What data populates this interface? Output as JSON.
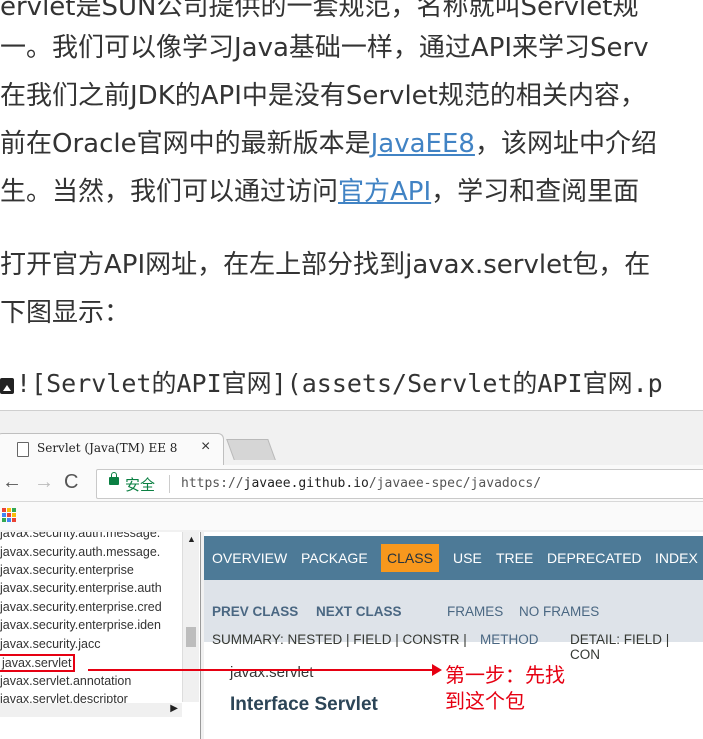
{
  "article": {
    "lines": [
      "ervlet是SUN公司提供的一套规范，名称就叫Servlet规",
      "一。我们可以像学习Java基础一样，通过API来学习Serv",
      "在我们之前JDK的API中是没有Servlet规范的相关内容，"
    ],
    "line4_pre": "前在Oracle官网中的最新版本是",
    "line4_link": "JavaEE8",
    "line4_post": "，该网址中介绍",
    "line5_pre": "生。当然，我们可以通过访问",
    "line5_link": "官方API",
    "line5_post": "，学习和查阅里面",
    "para2_line1": "打开官方API网址，在左上部分找到javax.servlet包，在",
    "para2_line2": "下图显示：",
    "image_markdown": "![Servlet的API官网](assets/Servlet的API官网.p"
  },
  "browser": {
    "tab_title": "Servlet (Java(TM) EE 8",
    "tab_close": "×",
    "secure_label": "安全",
    "url_scheme": "https://",
    "url_host": "javaee.github.io",
    "url_path": "/javaee-spec/javadocs/",
    "nav": {
      "back": "←",
      "forward": "→",
      "reload": "C"
    }
  },
  "package_list": [
    "javax.security.auth.message.",
    "javax.security.auth.message.",
    "javax.security.enterprise",
    "javax.security.enterprise.auth",
    "javax.security.enterprise.cred",
    "javax.security.enterprise.iden",
    "javax.security.jacc",
    "javax.servlet",
    "javax.servlet.annotation",
    "javax.servlet.descriptor"
  ],
  "javadoc": {
    "topnav": [
      "OVERVIEW",
      "PACKAGE",
      "CLASS",
      "USE",
      "TREE",
      "DEPRECATED",
      "INDEX"
    ],
    "active_tab": "CLASS",
    "prev_class": "PREV CLASS",
    "next_class": "NEXT CLASS",
    "frames": "FRAMES",
    "no_frames": "NO FRAMES",
    "summary_prefix": "SUMMARY: NESTED | FIELD | CONSTR | ",
    "summary_method": "METHOD",
    "detail": "DETAIL: FIELD | CON",
    "package_name": "javax.servlet",
    "interface_title": "Interface Servlet"
  },
  "annotation": {
    "line1": "第一步：先找",
    "line2": "到这个包",
    "color": "#e60012"
  }
}
